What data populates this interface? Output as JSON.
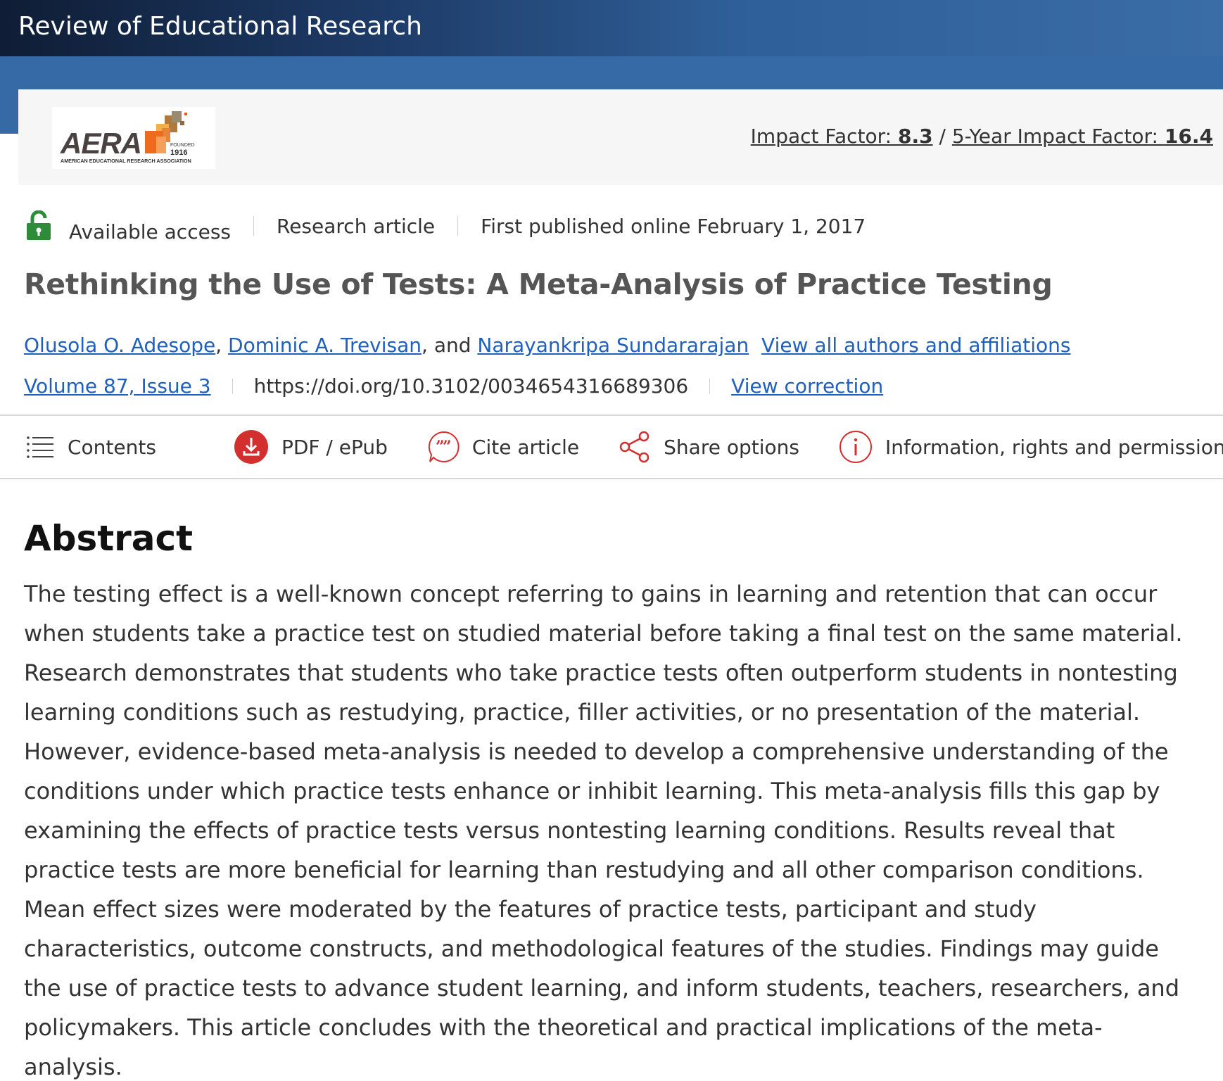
{
  "header": {
    "journal_title": "Review of Educational Research"
  },
  "brand": {
    "logo_text": "AERA",
    "logo_founded": "FOUNDED",
    "logo_year": "1916",
    "logo_subtitle": "AMERICAN EDUCATIONAL RESEARCH ASSOCIATION",
    "impact_label": "Impact Factor:",
    "impact_value": "8.3",
    "impact_sep": "/",
    "five_year_label": "5-Year Impact Factor:",
    "five_year_value": "16.4"
  },
  "meta": {
    "access": "Available access",
    "article_type": "Research article",
    "published": "First published online February 1, 2017"
  },
  "article": {
    "title": "Rethinking the Use of Tests: A Meta-Analysis of Practice Testing",
    "authors": [
      "Olusola O. Adesope",
      "Dominic A. Trevisan",
      "Narayankripa Sundararajan"
    ],
    "author_sep_1": ",",
    "author_sep_2": ", and",
    "view_all_authors": "View all authors and affiliations",
    "volume_issue": "Volume 87, Issue 3",
    "doi": "https://doi.org/10.3102/0034654316689306",
    "view_correction": "View correction"
  },
  "toolbar": {
    "contents": "Contents",
    "pdf": "PDF / ePub",
    "cite": "Cite article",
    "share": "Share options",
    "info": "Information, rights and permissions"
  },
  "abstract": {
    "heading": "Abstract",
    "text": "The testing effect is a well-known concept referring to gains in learning and retention that can occur when students take a practice test on studied material before taking a final test on the same material. Research demonstrates that students who take practice tests often outperform students in nontesting learning conditions such as restudying, practice, filler activities, or no presentation of the material. However, evidence-based meta-analysis is needed to develop a comprehensive understanding of the conditions under which practice tests enhance or inhibit learning. This meta-analysis fills this gap by examining the effects of practice tests versus nontesting learning conditions. Results reveal that practice tests are more beneficial for learning than restudying and all other comparison conditions. Mean effect sizes were moderated by the features of practice tests, participant and study characteristics, outcome constructs, and methodological features of the studies. Findings may guide the use of practice tests to advance student learning, and inform students, teachers, researchers, and policymakers. This article concludes with the theoretical and practical implications of the meta-analysis."
  },
  "colors": {
    "link": "#1f5fbe",
    "accent_red": "#d32f2f",
    "lock_green": "#2e8b3a",
    "header_dark": "#0f1d35",
    "header_blue": "#356aa6"
  }
}
